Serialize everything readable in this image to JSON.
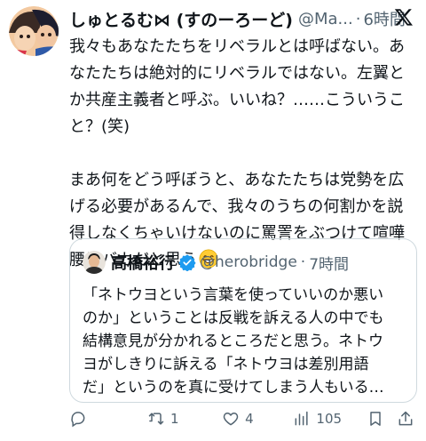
{
  "tweet": {
    "display_name": "しゅとるむ⋈ (すのーろーど)",
    "handle": "@Ma...",
    "separator": "·",
    "time": "6時間",
    "paragraph1": "我々もあなたたちをリベラルとは呼ばない。あ\nなたたちは絶対的にリベラルではない。左翼と\nか共産主義者と呼ぶ。いいね？……こういうこ\nと？(笑)",
    "paragraph2": "まあ何をどう呼ぼうと、あなたたちは党勢を広\nげる必要があるんで、我々のうちの何割かを説\n得しなくちゃいけないのに罵詈をぶつけて喧嘩\n腰はバカだと思う",
    "emoji": "grinning-face-with-smiling-eyes"
  },
  "quote": {
    "name": "高橋裕行",
    "handle": "@herobridge",
    "separator": "·",
    "time": "7時間",
    "text": "「ネトウヨという言葉を使っていいのか悪い\nのか」ということは反戦を訴える人の中でも\n結構意見が分かれるところだと思う。ネトウ\nヨがしきりに訴える「ネトウヨは差別用語\nだ」というのを真に受けてしまう人もいる…"
  },
  "actions": {
    "reply_count": "",
    "retweet_count": "1",
    "like_count": "4",
    "views_count": "105"
  },
  "colors": {
    "text": "#0f1419",
    "secondary": "#536471",
    "border": "#cfd9de",
    "verified": "#1d9bf0"
  }
}
